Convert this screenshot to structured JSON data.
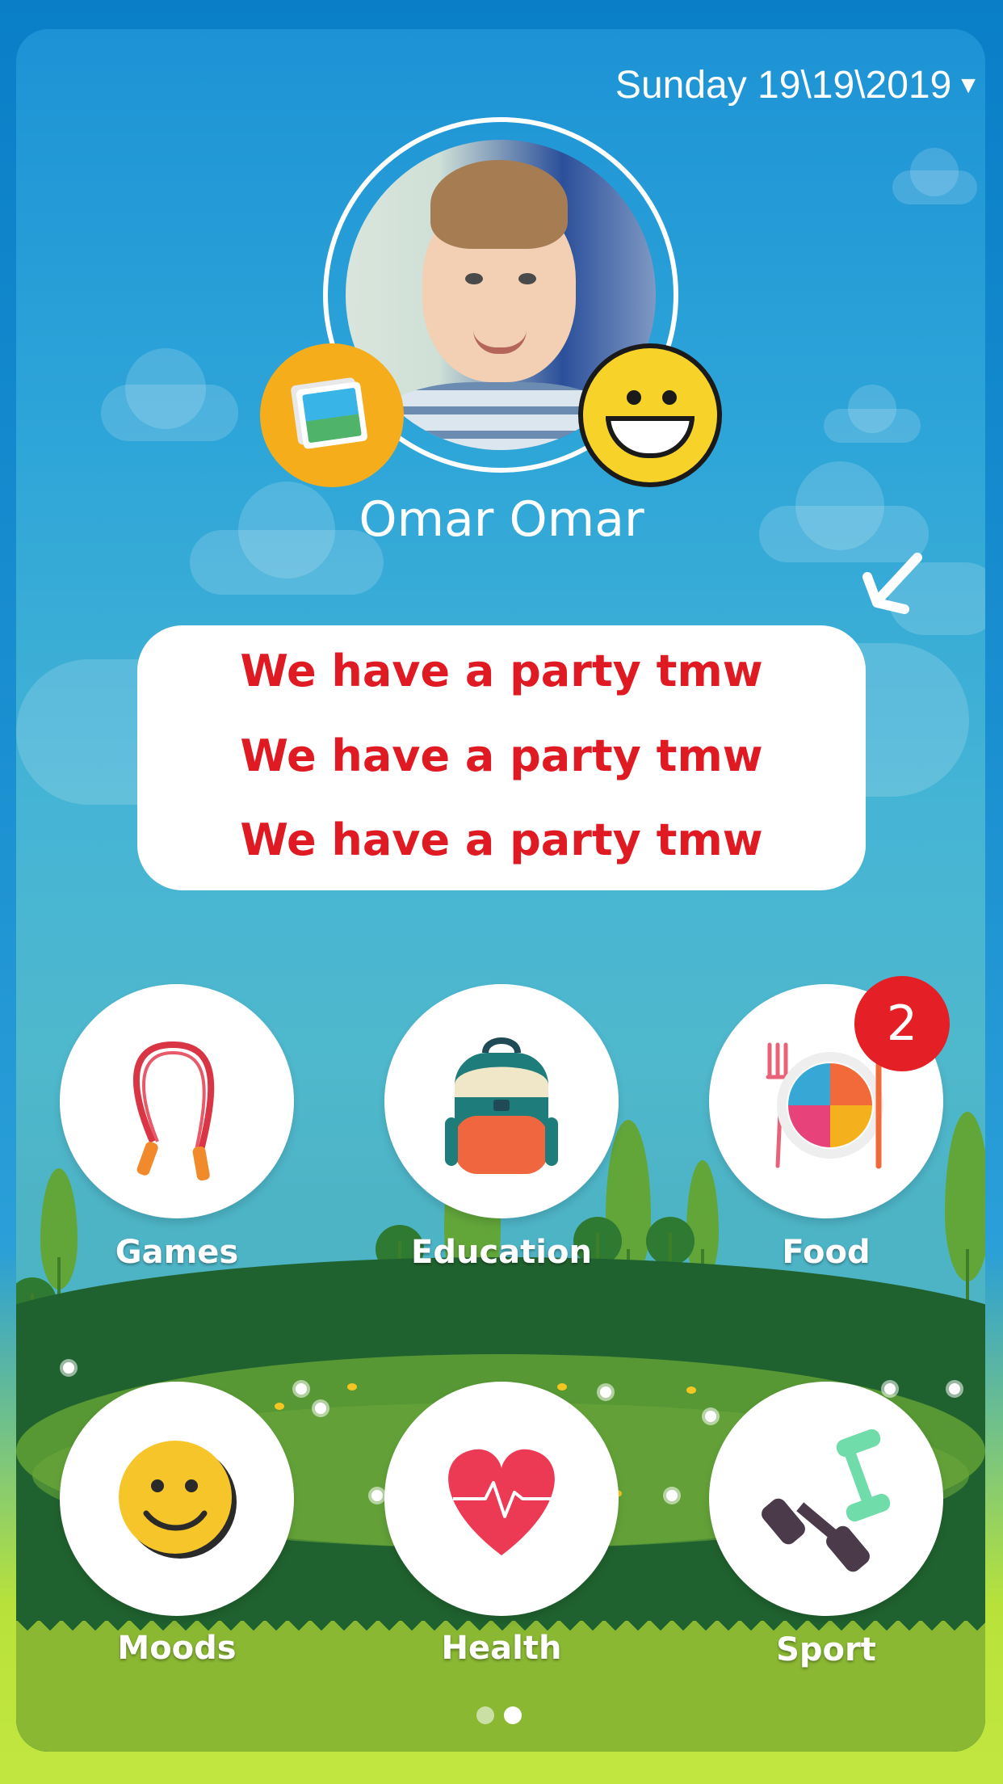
{
  "header": {
    "date": "Sunday 19\\19\\2019",
    "date_dropdown_icon": "caret-down-icon"
  },
  "profile": {
    "name": "Omar Omar",
    "photo_button_icon": "image-icon",
    "mood_button_icon": "grinning-face-icon"
  },
  "message": {
    "lines": [
      "We have a party tmw",
      "We have a party tmw",
      "We have a party tmw"
    ]
  },
  "tiles": [
    {
      "label": "Games",
      "icon": "jump-rope-icon"
    },
    {
      "label": "Education",
      "icon": "backpack-icon"
    },
    {
      "label": "Food",
      "icon": "food-plate-icon",
      "badge": "2"
    },
    {
      "label": "Moods",
      "icon": "smiley-icon"
    },
    {
      "label": "Health",
      "icon": "heartbeat-icon"
    },
    {
      "label": "Sport",
      "icon": "dumbbell-icon"
    }
  ],
  "pager": {
    "count": 2,
    "active_index": 1
  },
  "colors": {
    "message_text": "#e01a22",
    "badge": "#e41f26",
    "photo_button": "#f5ad1c",
    "emoji": "#f7d228"
  }
}
